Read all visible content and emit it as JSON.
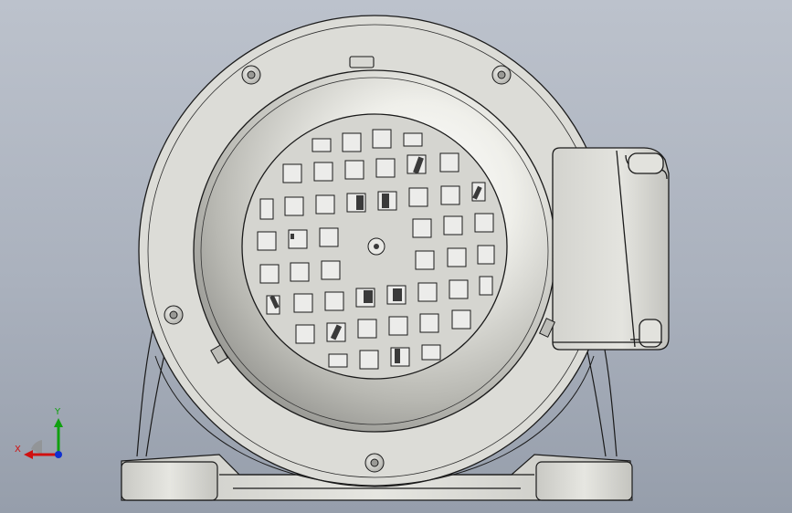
{
  "viewport": {
    "background_top": "#bcc2cc",
    "background_bottom": "#969eab"
  },
  "triad": {
    "x_label": "X",
    "y_label": "Y",
    "x_color": "#d01010",
    "y_color": "#10a010",
    "z_color": "#1030d0"
  },
  "model": {
    "body_color": "#d9d9d4",
    "edge_color": "#1a1a1a",
    "fan_cover_color": "#cfcfca"
  }
}
